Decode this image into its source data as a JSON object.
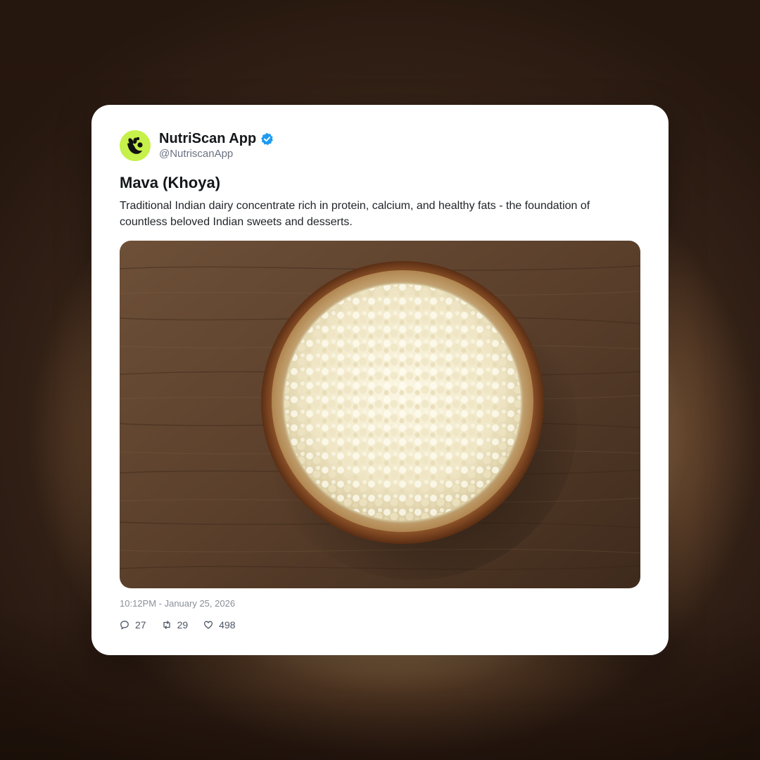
{
  "account": {
    "display_name": "NutriScan App",
    "handle": "@NutriscanApp",
    "avatar_color": "#c6f04a",
    "verified_color": "#1d9bf0"
  },
  "post": {
    "title": "Mava (Khoya)",
    "description": "Traditional Indian dairy concentrate rich in protein, calcium, and healthy fats - the foundation of countless beloved Indian sweets and desserts.",
    "timestamp": "10:12PM - January 25, 2026",
    "image_subject": "bowl of mava on wooden table"
  },
  "stats": {
    "replies": "27",
    "reposts": "29",
    "likes": "498"
  },
  "icons": {
    "reply": "reply-icon",
    "repost": "repost-icon",
    "like": "heart-icon",
    "verified": "verified-badge-icon"
  }
}
